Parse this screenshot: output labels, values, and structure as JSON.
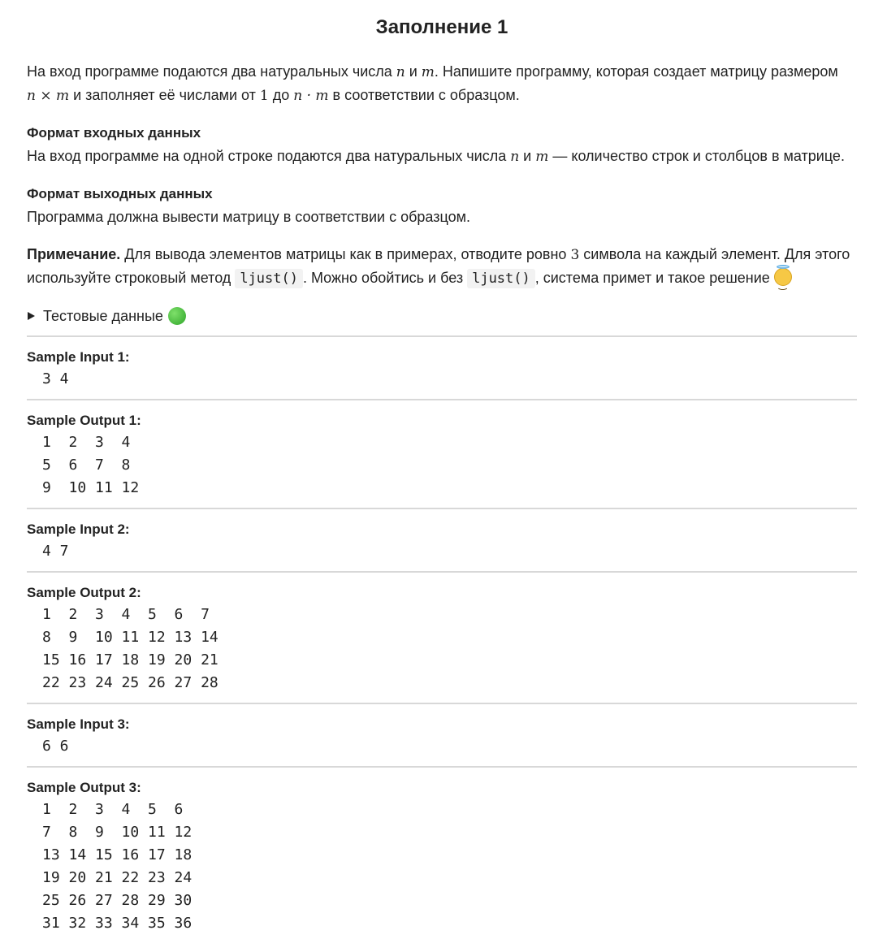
{
  "title": "Заполнение 1",
  "intro": {
    "t1": "На вход программе подаются два натуральных числа ",
    "n": "n",
    "and": " и ",
    "m": "m",
    "t2": ". Напишите программу, которая создает матрицу размером",
    "nxm": "n × m",
    "t3": " и заполняет её числами от ",
    "one": "1",
    "t4": " до ",
    "ndotm": "n · m",
    "t5": " в соответствии с образцом."
  },
  "input_format": {
    "heading": "Формат входных данных",
    "t1": "На вход программе на одной строке подаются два натуральных числа ",
    "n": "n",
    "and": " и ",
    "m": "m",
    "t2": " — количество строк и столбцов в матрице."
  },
  "output_format": {
    "heading": "Формат выходных данных",
    "text": "Программа должна вывести матрицу в соответствии с образцом."
  },
  "note": {
    "label": "Примечание.",
    "t1": " Для вывода элементов матрицы как в примерах, отводите ровно ",
    "three": "3",
    "t2": " символа на каждый элемент. Для этого используйте строковый метод ",
    "code1": "ljust()",
    "t3": ". Можно обойтись и без ",
    "code2": "ljust()",
    "t4": ", система примет и такое решение ",
    "emoji": "smiling-face-with-halo-icon"
  },
  "test_data": {
    "label": "Тестовые данные",
    "icon": "green-circle-icon"
  },
  "samples": [
    {
      "label": "Sample Input 1:",
      "body": "3 4"
    },
    {
      "label": "Sample Output 1:",
      "body": "1  2  3  4\n5  6  7  8\n9  10 11 12"
    },
    {
      "label": "Sample Input 2:",
      "body": "4 7"
    },
    {
      "label": "Sample Output 2:",
      "body": "1  2  3  4  5  6  7\n8  9  10 11 12 13 14\n15 16 17 18 19 20 21\n22 23 24 25 26 27 28"
    },
    {
      "label": "Sample Input 3:",
      "body": "6 6"
    },
    {
      "label": "Sample Output 3:",
      "body": "1  2  3  4  5  6\n7  8  9  10 11 12\n13 14 15 16 17 18\n19 20 21 22 23 24\n25 26 27 28 29 30\n31 32 33 34 35 36"
    }
  ]
}
